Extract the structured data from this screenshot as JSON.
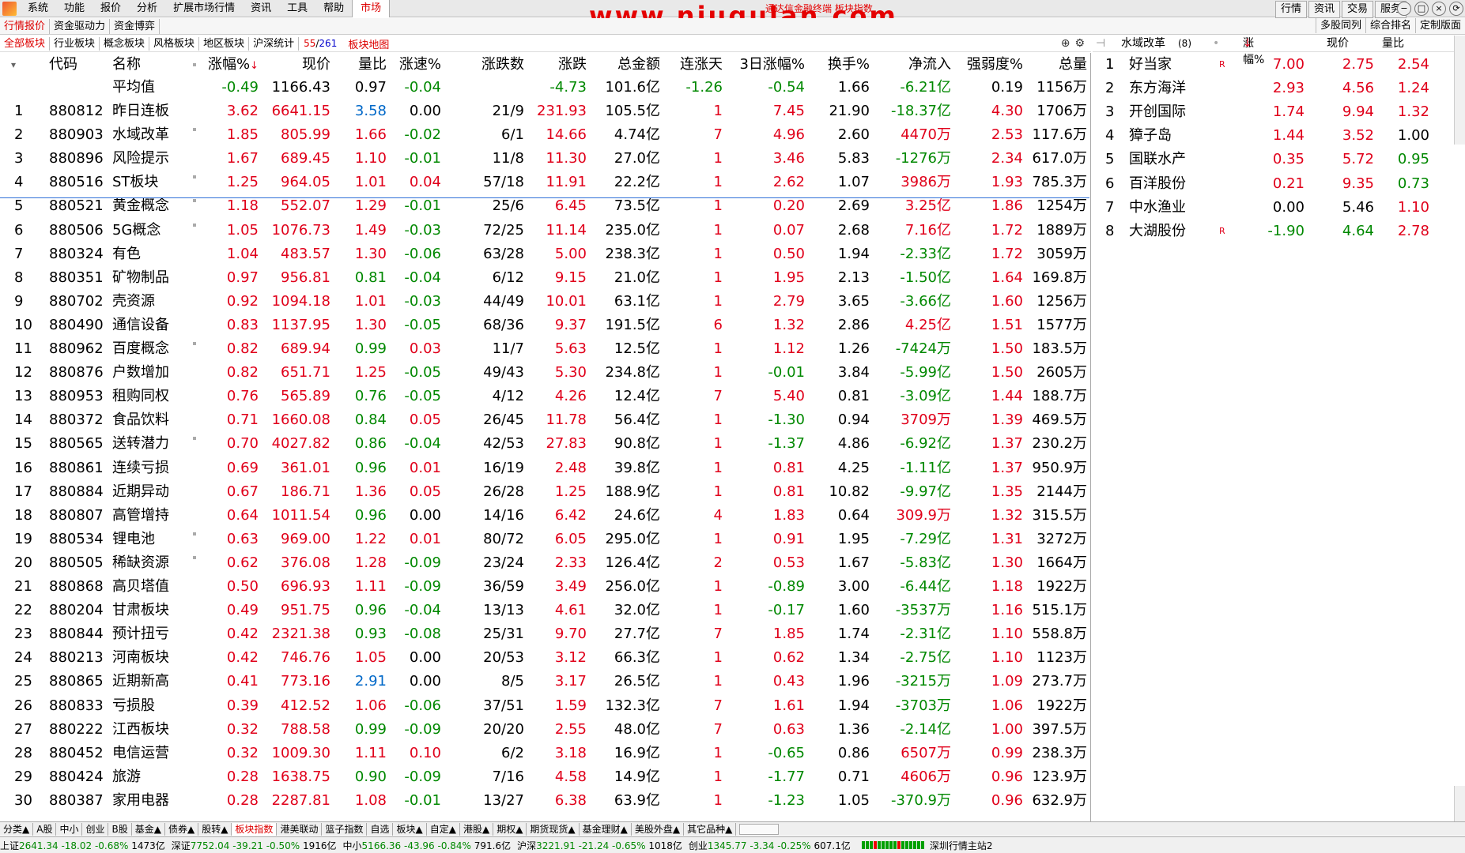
{
  "menu": {
    "items": [
      "系统",
      "功能",
      "报价",
      "分析",
      "扩展市场行情",
      "资讯",
      "工具",
      "帮助",
      "市场"
    ],
    "watermark": "www.niugulan.com",
    "watermark_sub": "通达信金融终端 板块指数",
    "right_buttons": [
      "行情",
      "资讯",
      "交易",
      "服务"
    ],
    "window_controls": [
      "−",
      "□",
      "×",
      "⟳"
    ]
  },
  "tabs2": {
    "left": [
      "行情报价",
      "资金驱动力",
      "资金博弈"
    ],
    "right": [
      "多股同列",
      "综合排名",
      "定制版面"
    ]
  },
  "tabs3": {
    "items": [
      "全部板块",
      "行业板块",
      "概念板块",
      "风格板块",
      "地区板块",
      "沪深统计"
    ],
    "count_a": "55",
    "count_sep": "/",
    "count_b": "261",
    "map": "板块地图"
  },
  "table": {
    "headers": [
      "代码",
      "名称",
      "涨幅%",
      "现价",
      "量比",
      "涨速%",
      "涨跌数",
      "涨跌",
      "总金额",
      "连涨天",
      "3日涨幅%",
      "换手%",
      "净流入",
      "强弱度%",
      "总量"
    ],
    "sort_arrow": "↓",
    "average": {
      "label": "平均值",
      "values": [
        "-0.49",
        "1166.43",
        "0.97",
        "-0.04",
        "",
        "-4.73",
        "101.6亿",
        "-1.26",
        "-0.54",
        "1.66",
        "-6.21亿",
        "0.19",
        "1156万"
      ]
    },
    "rows": [
      [
        "1",
        "880812",
        "昨日连板",
        "3.62",
        "6641.15",
        "3.58",
        "0.00",
        "21/9",
        "231.93",
        "105.5亿",
        "1",
        "7.45",
        "21.90",
        "-18.37亿",
        "4.30",
        "1706万"
      ],
      [
        "2",
        "880903",
        "水域改革",
        "1.85",
        "805.99",
        "1.66",
        "-0.02",
        "6/1",
        "14.66",
        "4.74亿",
        "7",
        "4.96",
        "2.60",
        "4470万",
        "2.53",
        "117.6万"
      ],
      [
        "3",
        "880896",
        "风险提示",
        "1.67",
        "689.45",
        "1.10",
        "-0.01",
        "11/8",
        "11.30",
        "27.0亿",
        "1",
        "3.46",
        "5.83",
        "-1276万",
        "2.34",
        "617.0万"
      ],
      [
        "4",
        "880516",
        "ST板块",
        "1.25",
        "964.05",
        "1.01",
        "0.04",
        "57/18",
        "11.91",
        "22.2亿",
        "1",
        "2.62",
        "1.07",
        "3986万",
        "1.93",
        "785.3万"
      ],
      [
        "5",
        "880521",
        "黄金概念",
        "1.18",
        "552.07",
        "1.29",
        "-0.01",
        "25/6",
        "6.45",
        "73.5亿",
        "1",
        "0.20",
        "2.69",
        "3.25亿",
        "1.86",
        "1254万"
      ],
      [
        "6",
        "880506",
        "5G概念",
        "1.05",
        "1076.73",
        "1.49",
        "-0.03",
        "72/25",
        "11.14",
        "235.0亿",
        "1",
        "0.07",
        "2.68",
        "7.16亿",
        "1.72",
        "1889万"
      ],
      [
        "7",
        "880324",
        "有色",
        "1.04",
        "483.57",
        "1.30",
        "-0.06",
        "63/28",
        "5.00",
        "238.3亿",
        "1",
        "0.50",
        "1.94",
        "-2.33亿",
        "1.72",
        "3059万"
      ],
      [
        "8",
        "880351",
        "矿物制品",
        "0.97",
        "956.81",
        "0.81",
        "-0.04",
        "6/12",
        "9.15",
        "21.0亿",
        "1",
        "1.95",
        "2.13",
        "-1.50亿",
        "1.64",
        "169.8万"
      ],
      [
        "9",
        "880702",
        "壳资源",
        "0.92",
        "1094.18",
        "1.01",
        "-0.03",
        "44/49",
        "10.01",
        "63.1亿",
        "1",
        "2.79",
        "3.65",
        "-3.66亿",
        "1.60",
        "1256万"
      ],
      [
        "10",
        "880490",
        "通信设备",
        "0.83",
        "1137.95",
        "1.30",
        "-0.05",
        "68/36",
        "9.37",
        "191.5亿",
        "6",
        "1.32",
        "2.86",
        "4.25亿",
        "1.51",
        "1577万"
      ],
      [
        "11",
        "880962",
        "百度概念",
        "0.82",
        "689.94",
        "0.99",
        "0.03",
        "11/7",
        "5.63",
        "12.5亿",
        "1",
        "1.12",
        "1.26",
        "-7424万",
        "1.50",
        "183.5万"
      ],
      [
        "12",
        "880876",
        "户数增加",
        "0.82",
        "651.71",
        "1.25",
        "-0.05",
        "49/43",
        "5.30",
        "234.8亿",
        "1",
        "-0.01",
        "3.84",
        "-5.99亿",
        "1.50",
        "2605万"
      ],
      [
        "13",
        "880953",
        "租购同权",
        "0.76",
        "565.89",
        "0.76",
        "-0.05",
        "4/12",
        "4.26",
        "12.4亿",
        "7",
        "5.40",
        "0.81",
        "-3.09亿",
        "1.44",
        "188.7万"
      ],
      [
        "14",
        "880372",
        "食品饮料",
        "0.71",
        "1660.08",
        "0.84",
        "0.05",
        "26/45",
        "11.78",
        "56.4亿",
        "1",
        "-1.30",
        "0.94",
        "3709万",
        "1.39",
        "469.5万"
      ],
      [
        "15",
        "880565",
        "送转潜力",
        "0.70",
        "4027.82",
        "0.86",
        "-0.04",
        "42/53",
        "27.83",
        "90.8亿",
        "1",
        "-1.37",
        "4.86",
        "-6.92亿",
        "1.37",
        "230.2万"
      ],
      [
        "16",
        "880861",
        "连续亏损",
        "0.69",
        "361.01",
        "0.96",
        "0.01",
        "16/19",
        "2.48",
        "39.8亿",
        "1",
        "0.81",
        "4.25",
        "-1.11亿",
        "1.37",
        "950.9万"
      ],
      [
        "17",
        "880884",
        "近期异动",
        "0.67",
        "186.71",
        "1.36",
        "0.05",
        "26/28",
        "1.25",
        "188.9亿",
        "1",
        "0.81",
        "10.82",
        "-9.97亿",
        "1.35",
        "2144万"
      ],
      [
        "18",
        "880807",
        "高管增持",
        "0.64",
        "1011.54",
        "0.96",
        "0.00",
        "14/16",
        "6.42",
        "24.6亿",
        "4",
        "1.83",
        "0.64",
        "309.9万",
        "1.32",
        "315.5万"
      ],
      [
        "19",
        "880534",
        "锂电池",
        "0.63",
        "969.00",
        "1.22",
        "0.01",
        "80/72",
        "6.05",
        "295.0亿",
        "1",
        "0.91",
        "1.95",
        "-7.29亿",
        "1.31",
        "3272万"
      ],
      [
        "20",
        "880505",
        "稀缺资源",
        "0.62",
        "376.08",
        "1.28",
        "-0.09",
        "23/24",
        "2.33",
        "126.4亿",
        "2",
        "0.53",
        "1.67",
        "-5.83亿",
        "1.30",
        "1664万"
      ],
      [
        "21",
        "880868",
        "高贝塔值",
        "0.50",
        "696.93",
        "1.11",
        "-0.09",
        "36/59",
        "3.49",
        "256.0亿",
        "1",
        "-0.89",
        "3.00",
        "-6.44亿",
        "1.18",
        "1922万"
      ],
      [
        "22",
        "880204",
        "甘肃板块",
        "0.49",
        "951.75",
        "0.96",
        "-0.04",
        "13/13",
        "4.61",
        "32.0亿",
        "1",
        "-0.17",
        "1.60",
        "-3537万",
        "1.16",
        "515.1万"
      ],
      [
        "23",
        "880844",
        "预计扭亏",
        "0.42",
        "2321.38",
        "0.93",
        "-0.08",
        "25/31",
        "9.70",
        "27.7亿",
        "7",
        "1.85",
        "1.74",
        "-2.31亿",
        "1.10",
        "558.8万"
      ],
      [
        "24",
        "880213",
        "河南板块",
        "0.42",
        "746.76",
        "1.05",
        "0.00",
        "20/53",
        "3.12",
        "66.3亿",
        "1",
        "0.62",
        "1.34",
        "-2.75亿",
        "1.10",
        "1123万"
      ],
      [
        "25",
        "880865",
        "近期新高",
        "0.41",
        "773.16",
        "2.91",
        "0.00",
        "8/5",
        "3.17",
        "26.5亿",
        "1",
        "0.43",
        "1.96",
        "-3215万",
        "1.09",
        "273.7万"
      ],
      [
        "26",
        "880833",
        "亏损股",
        "0.39",
        "412.52",
        "1.06",
        "-0.06",
        "37/51",
        "1.59",
        "132.3亿",
        "7",
        "1.61",
        "1.94",
        "-3703万",
        "1.06",
        "1922万"
      ],
      [
        "27",
        "880222",
        "江西板块",
        "0.32",
        "788.58",
        "0.99",
        "-0.09",
        "20/20",
        "2.55",
        "48.0亿",
        "7",
        "0.63",
        "1.36",
        "-2.14亿",
        "1.00",
        "397.5万"
      ],
      [
        "28",
        "880452",
        "电信运营",
        "0.32",
        "1009.30",
        "1.11",
        "0.10",
        "6/2",
        "3.18",
        "16.9亿",
        "1",
        "-0.65",
        "0.86",
        "6507万",
        "0.99",
        "238.3万"
      ],
      [
        "29",
        "880424",
        "旅游",
        "0.28",
        "1638.75",
        "0.90",
        "-0.09",
        "7/16",
        "4.58",
        "14.9亿",
        "1",
        "-1.77",
        "0.71",
        "4606万",
        "0.96",
        "123.9万"
      ],
      [
        "30",
        "880387",
        "家用电器",
        "0.28",
        "2287.81",
        "1.08",
        "-0.01",
        "13/27",
        "6.38",
        "63.9亿",
        "1",
        "-1.23",
        "1.05",
        "-370.9万",
        "0.96",
        "632.9万"
      ]
    ]
  },
  "side": {
    "title": "水域改革",
    "count": "(8)",
    "headers": [
      "涨幅%",
      "现价",
      "量比"
    ],
    "rows": [
      [
        "1",
        "好当家",
        "R",
        "7.00",
        "2.75",
        "2.54"
      ],
      [
        "2",
        "东方海洋",
        "",
        "2.93",
        "4.56",
        "1.24"
      ],
      [
        "3",
        "开创国际",
        "",
        "1.74",
        "9.94",
        "1.32"
      ],
      [
        "4",
        "獐子岛",
        "",
        "1.44",
        "3.52",
        "1.00"
      ],
      [
        "5",
        "国联水产",
        "",
        "0.35",
        "5.72",
        "0.95"
      ],
      [
        "6",
        "百洋股份",
        "",
        "0.21",
        "9.35",
        "0.73"
      ],
      [
        "7",
        "中水渔业",
        "",
        "0.00",
        "5.46",
        "1.10"
      ],
      [
        "8",
        "大湖股份",
        "R",
        "-1.90",
        "4.64",
        "2.78"
      ]
    ]
  },
  "bottom_tabs": [
    "分类▲",
    "A股",
    "中小",
    "创业",
    "B股",
    "基金▲",
    "债券▲",
    "股转▲",
    "板块指数",
    "港美联动",
    "篮子指数",
    "自选",
    "板块▲",
    "自定▲",
    "港股▲",
    "期权▲",
    "期货现货▲",
    "基金理财▲",
    "美股外盘▲",
    "其它品种▲"
  ],
  "status": {
    "items": [
      {
        "name": "上证",
        "price": "2641.34",
        "chg": "-18.02",
        "pct": "-0.68%",
        "amt": "1473亿"
      },
      {
        "name": "深证",
        "price": "7752.04",
        "chg": "-39.21",
        "pct": "-0.50%",
        "amt": "1916亿"
      },
      {
        "name": "中小",
        "price": "5166.36",
        "chg": "-43.96",
        "pct": "-0.84%",
        "amt": "791.6亿"
      },
      {
        "name": "沪深",
        "price": "3221.91",
        "chg": "-21.24",
        "pct": "-0.65%",
        "amt": "1018亿"
      },
      {
        "name": "创业",
        "price": "1345.77",
        "chg": "-3.34",
        "pct": "-0.25%",
        "amt": "607.1亿"
      }
    ],
    "server": "深圳行情主站2"
  },
  "colors": {
    "up": "#e0001a",
    "down": "#008800",
    "accent": "#0068c8"
  }
}
